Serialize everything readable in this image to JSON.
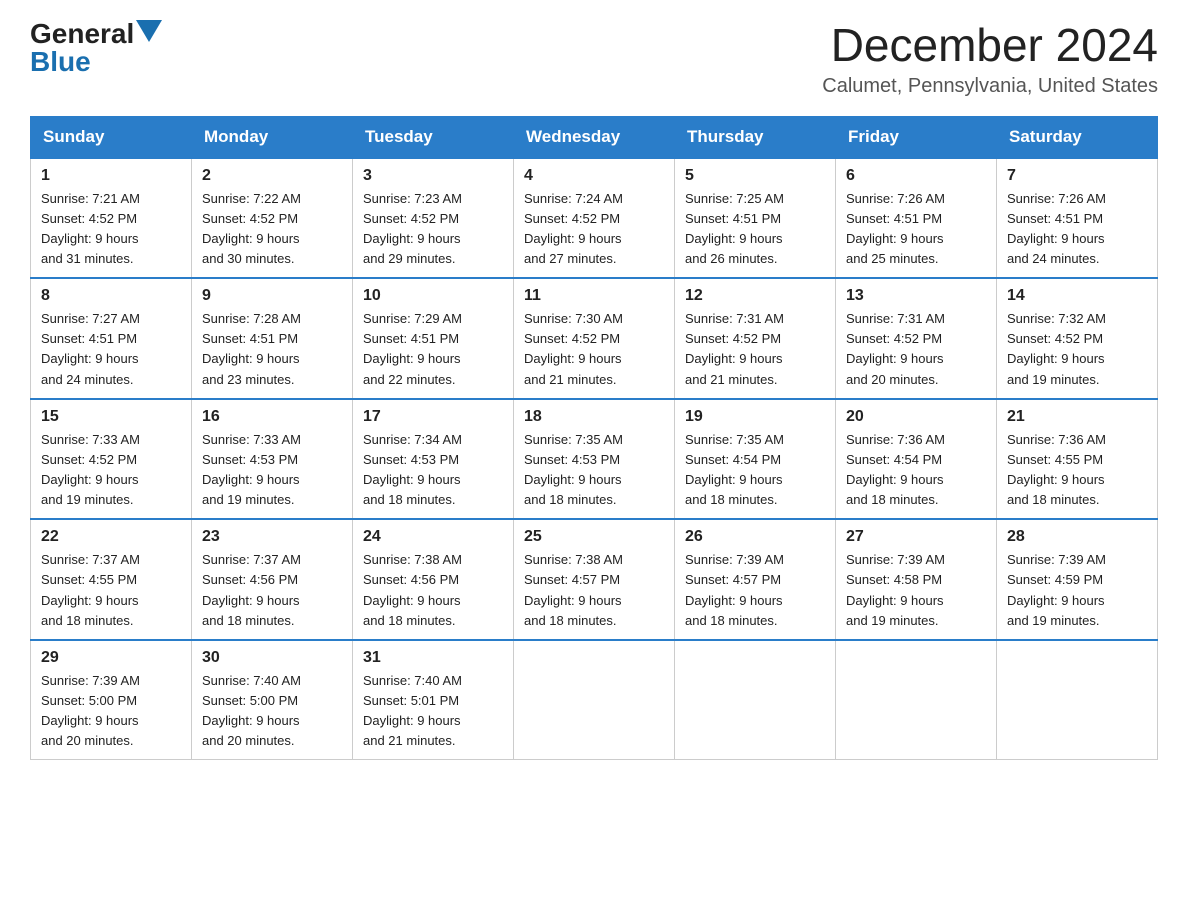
{
  "header": {
    "logo_general": "General",
    "logo_blue": "Blue",
    "month_title": "December 2024",
    "location": "Calumet, Pennsylvania, United States"
  },
  "weekdays": [
    "Sunday",
    "Monday",
    "Tuesday",
    "Wednesday",
    "Thursday",
    "Friday",
    "Saturday"
  ],
  "weeks": [
    [
      {
        "day": "1",
        "sunrise": "7:21 AM",
        "sunset": "4:52 PM",
        "daylight": "9 hours and 31 minutes."
      },
      {
        "day": "2",
        "sunrise": "7:22 AM",
        "sunset": "4:52 PM",
        "daylight": "9 hours and 30 minutes."
      },
      {
        "day": "3",
        "sunrise": "7:23 AM",
        "sunset": "4:52 PM",
        "daylight": "9 hours and 29 minutes."
      },
      {
        "day": "4",
        "sunrise": "7:24 AM",
        "sunset": "4:52 PM",
        "daylight": "9 hours and 27 minutes."
      },
      {
        "day": "5",
        "sunrise": "7:25 AM",
        "sunset": "4:51 PM",
        "daylight": "9 hours and 26 minutes."
      },
      {
        "day": "6",
        "sunrise": "7:26 AM",
        "sunset": "4:51 PM",
        "daylight": "9 hours and 25 minutes."
      },
      {
        "day": "7",
        "sunrise": "7:26 AM",
        "sunset": "4:51 PM",
        "daylight": "9 hours and 24 minutes."
      }
    ],
    [
      {
        "day": "8",
        "sunrise": "7:27 AM",
        "sunset": "4:51 PM",
        "daylight": "9 hours and 24 minutes."
      },
      {
        "day": "9",
        "sunrise": "7:28 AM",
        "sunset": "4:51 PM",
        "daylight": "9 hours and 23 minutes."
      },
      {
        "day": "10",
        "sunrise": "7:29 AM",
        "sunset": "4:51 PM",
        "daylight": "9 hours and 22 minutes."
      },
      {
        "day": "11",
        "sunrise": "7:30 AM",
        "sunset": "4:52 PM",
        "daylight": "9 hours and 21 minutes."
      },
      {
        "day": "12",
        "sunrise": "7:31 AM",
        "sunset": "4:52 PM",
        "daylight": "9 hours and 21 minutes."
      },
      {
        "day": "13",
        "sunrise": "7:31 AM",
        "sunset": "4:52 PM",
        "daylight": "9 hours and 20 minutes."
      },
      {
        "day": "14",
        "sunrise": "7:32 AM",
        "sunset": "4:52 PM",
        "daylight": "9 hours and 19 minutes."
      }
    ],
    [
      {
        "day": "15",
        "sunrise": "7:33 AM",
        "sunset": "4:52 PM",
        "daylight": "9 hours and 19 minutes."
      },
      {
        "day": "16",
        "sunrise": "7:33 AM",
        "sunset": "4:53 PM",
        "daylight": "9 hours and 19 minutes."
      },
      {
        "day": "17",
        "sunrise": "7:34 AM",
        "sunset": "4:53 PM",
        "daylight": "9 hours and 18 minutes."
      },
      {
        "day": "18",
        "sunrise": "7:35 AM",
        "sunset": "4:53 PM",
        "daylight": "9 hours and 18 minutes."
      },
      {
        "day": "19",
        "sunrise": "7:35 AM",
        "sunset": "4:54 PM",
        "daylight": "9 hours and 18 minutes."
      },
      {
        "day": "20",
        "sunrise": "7:36 AM",
        "sunset": "4:54 PM",
        "daylight": "9 hours and 18 minutes."
      },
      {
        "day": "21",
        "sunrise": "7:36 AM",
        "sunset": "4:55 PM",
        "daylight": "9 hours and 18 minutes."
      }
    ],
    [
      {
        "day": "22",
        "sunrise": "7:37 AM",
        "sunset": "4:55 PM",
        "daylight": "9 hours and 18 minutes."
      },
      {
        "day": "23",
        "sunrise": "7:37 AM",
        "sunset": "4:56 PM",
        "daylight": "9 hours and 18 minutes."
      },
      {
        "day": "24",
        "sunrise": "7:38 AM",
        "sunset": "4:56 PM",
        "daylight": "9 hours and 18 minutes."
      },
      {
        "day": "25",
        "sunrise": "7:38 AM",
        "sunset": "4:57 PM",
        "daylight": "9 hours and 18 minutes."
      },
      {
        "day": "26",
        "sunrise": "7:39 AM",
        "sunset": "4:57 PM",
        "daylight": "9 hours and 18 minutes."
      },
      {
        "day": "27",
        "sunrise": "7:39 AM",
        "sunset": "4:58 PM",
        "daylight": "9 hours and 19 minutes."
      },
      {
        "day": "28",
        "sunrise": "7:39 AM",
        "sunset": "4:59 PM",
        "daylight": "9 hours and 19 minutes."
      }
    ],
    [
      {
        "day": "29",
        "sunrise": "7:39 AM",
        "sunset": "5:00 PM",
        "daylight": "9 hours and 20 minutes."
      },
      {
        "day": "30",
        "sunrise": "7:40 AM",
        "sunset": "5:00 PM",
        "daylight": "9 hours and 20 minutes."
      },
      {
        "day": "31",
        "sunrise": "7:40 AM",
        "sunset": "5:01 PM",
        "daylight": "9 hours and 21 minutes."
      },
      null,
      null,
      null,
      null
    ]
  ],
  "labels": {
    "sunrise": "Sunrise:",
    "sunset": "Sunset:",
    "daylight": "Daylight:"
  }
}
